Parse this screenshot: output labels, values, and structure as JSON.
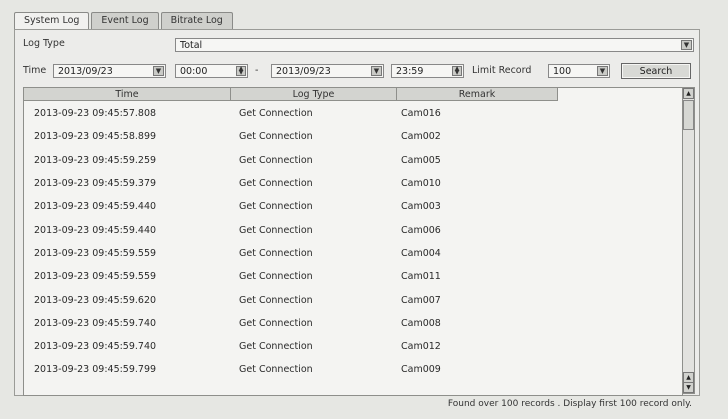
{
  "tabs": [
    {
      "label": "System Log"
    },
    {
      "label": "Event Log"
    },
    {
      "label": "Bitrate Log"
    }
  ],
  "filters": {
    "log_type_label": "Log Type",
    "log_type_value": "Total",
    "time_label": "Time",
    "start_date": "2013/09/23",
    "start_time": "00:00",
    "dash": "-",
    "end_date": "2013/09/23",
    "end_time": "23:59",
    "limit_label": "Limit Record",
    "limit_value": "100",
    "search_label": "Search"
  },
  "table": {
    "headers": [
      "Time",
      "Log Type",
      "Remark"
    ],
    "rows": [
      {
        "time": "2013-09-23 09:45:57.808",
        "type": "Get Connection",
        "remark": "Cam016"
      },
      {
        "time": "2013-09-23 09:45:58.899",
        "type": "Get Connection",
        "remark": "Cam002"
      },
      {
        "time": "2013-09-23 09:45:59.259",
        "type": "Get Connection",
        "remark": "Cam005"
      },
      {
        "time": "2013-09-23 09:45:59.379",
        "type": "Get Connection",
        "remark": "Cam010"
      },
      {
        "time": "2013-09-23 09:45:59.440",
        "type": "Get Connection",
        "remark": "Cam003"
      },
      {
        "time": "2013-09-23 09:45:59.440",
        "type": "Get Connection",
        "remark": "Cam006"
      },
      {
        "time": "2013-09-23 09:45:59.559",
        "type": "Get Connection",
        "remark": "Cam004"
      },
      {
        "time": "2013-09-23 09:45:59.559",
        "type": "Get Connection",
        "remark": "Cam011"
      },
      {
        "time": "2013-09-23 09:45:59.620",
        "type": "Get Connection",
        "remark": "Cam007"
      },
      {
        "time": "2013-09-23 09:45:59.740",
        "type": "Get Connection",
        "remark": "Cam008"
      },
      {
        "time": "2013-09-23 09:45:59.740",
        "type": "Get Connection",
        "remark": "Cam012"
      },
      {
        "time": "2013-09-23 09:45:59.799",
        "type": "Get Connection",
        "remark": "Cam009"
      }
    ]
  },
  "footer": "Found over 100 records . Display first 100 record only."
}
